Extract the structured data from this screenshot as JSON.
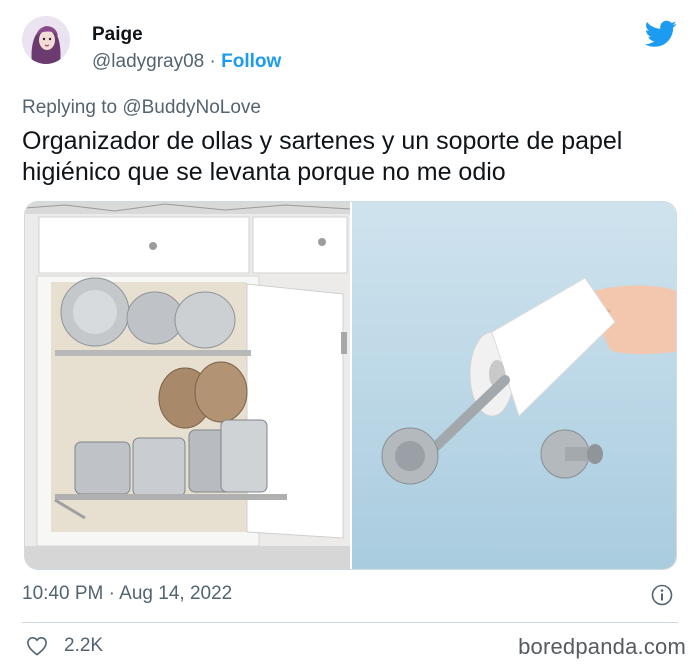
{
  "author": {
    "name": "Paige",
    "handle": "@ladygray08",
    "separator": "·",
    "follow_label": "Follow",
    "avatar_icon": "avatar-illustration"
  },
  "platform_icon": "twitter-bird-icon",
  "brand_color": "#1d9bf0",
  "reply": {
    "prefix": "Replying to",
    "mention": "@BuddyNoLove"
  },
  "tweet": {
    "text": "Organizador de ollas y sartenes y un soporte de papel higiénico que se levanta porque no me odio"
  },
  "media": {
    "left_image": "pots-and-pans-organizer-photo",
    "right_image": "toilet-paper-holder-photo"
  },
  "meta": {
    "time": "10:40 PM",
    "separator": "·",
    "date": "Aug 14, 2022",
    "info_icon": "info-icon"
  },
  "engagement": {
    "like_icon": "heart-icon",
    "likes": "2.2K"
  },
  "watermark": "boredpanda.com"
}
